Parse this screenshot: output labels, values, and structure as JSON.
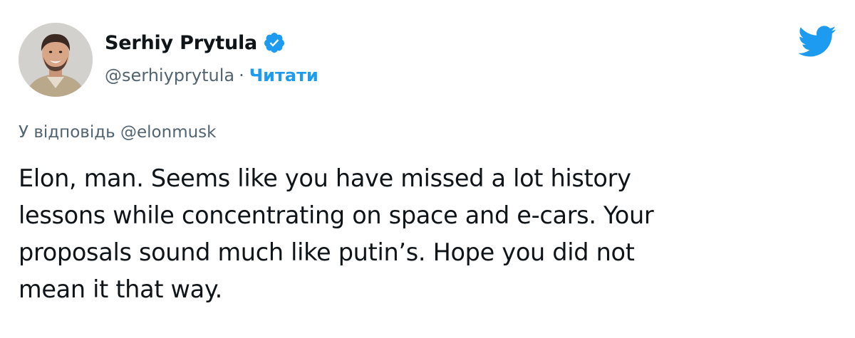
{
  "author": {
    "display_name": "Serhiy Prytula",
    "handle": "@serhiyprytula",
    "separator": "·",
    "follow_label": "Читати",
    "verified": true,
    "avatar": "profile-photo"
  },
  "brand": {
    "logo_icon": "twitter-bird-icon",
    "accent_color": "#1d9bf0",
    "verified_color": "#1d9bf0"
  },
  "reply": {
    "prefix": "У відповідь",
    "mention": "@elonmusk"
  },
  "tweet": {
    "text": "Elon, man. Seems like you have missed a lot history\nlessons while concentrating on space and e-cars. Your\nproposals sound much like putin’s. Hope you did not\nmean it that way."
  }
}
